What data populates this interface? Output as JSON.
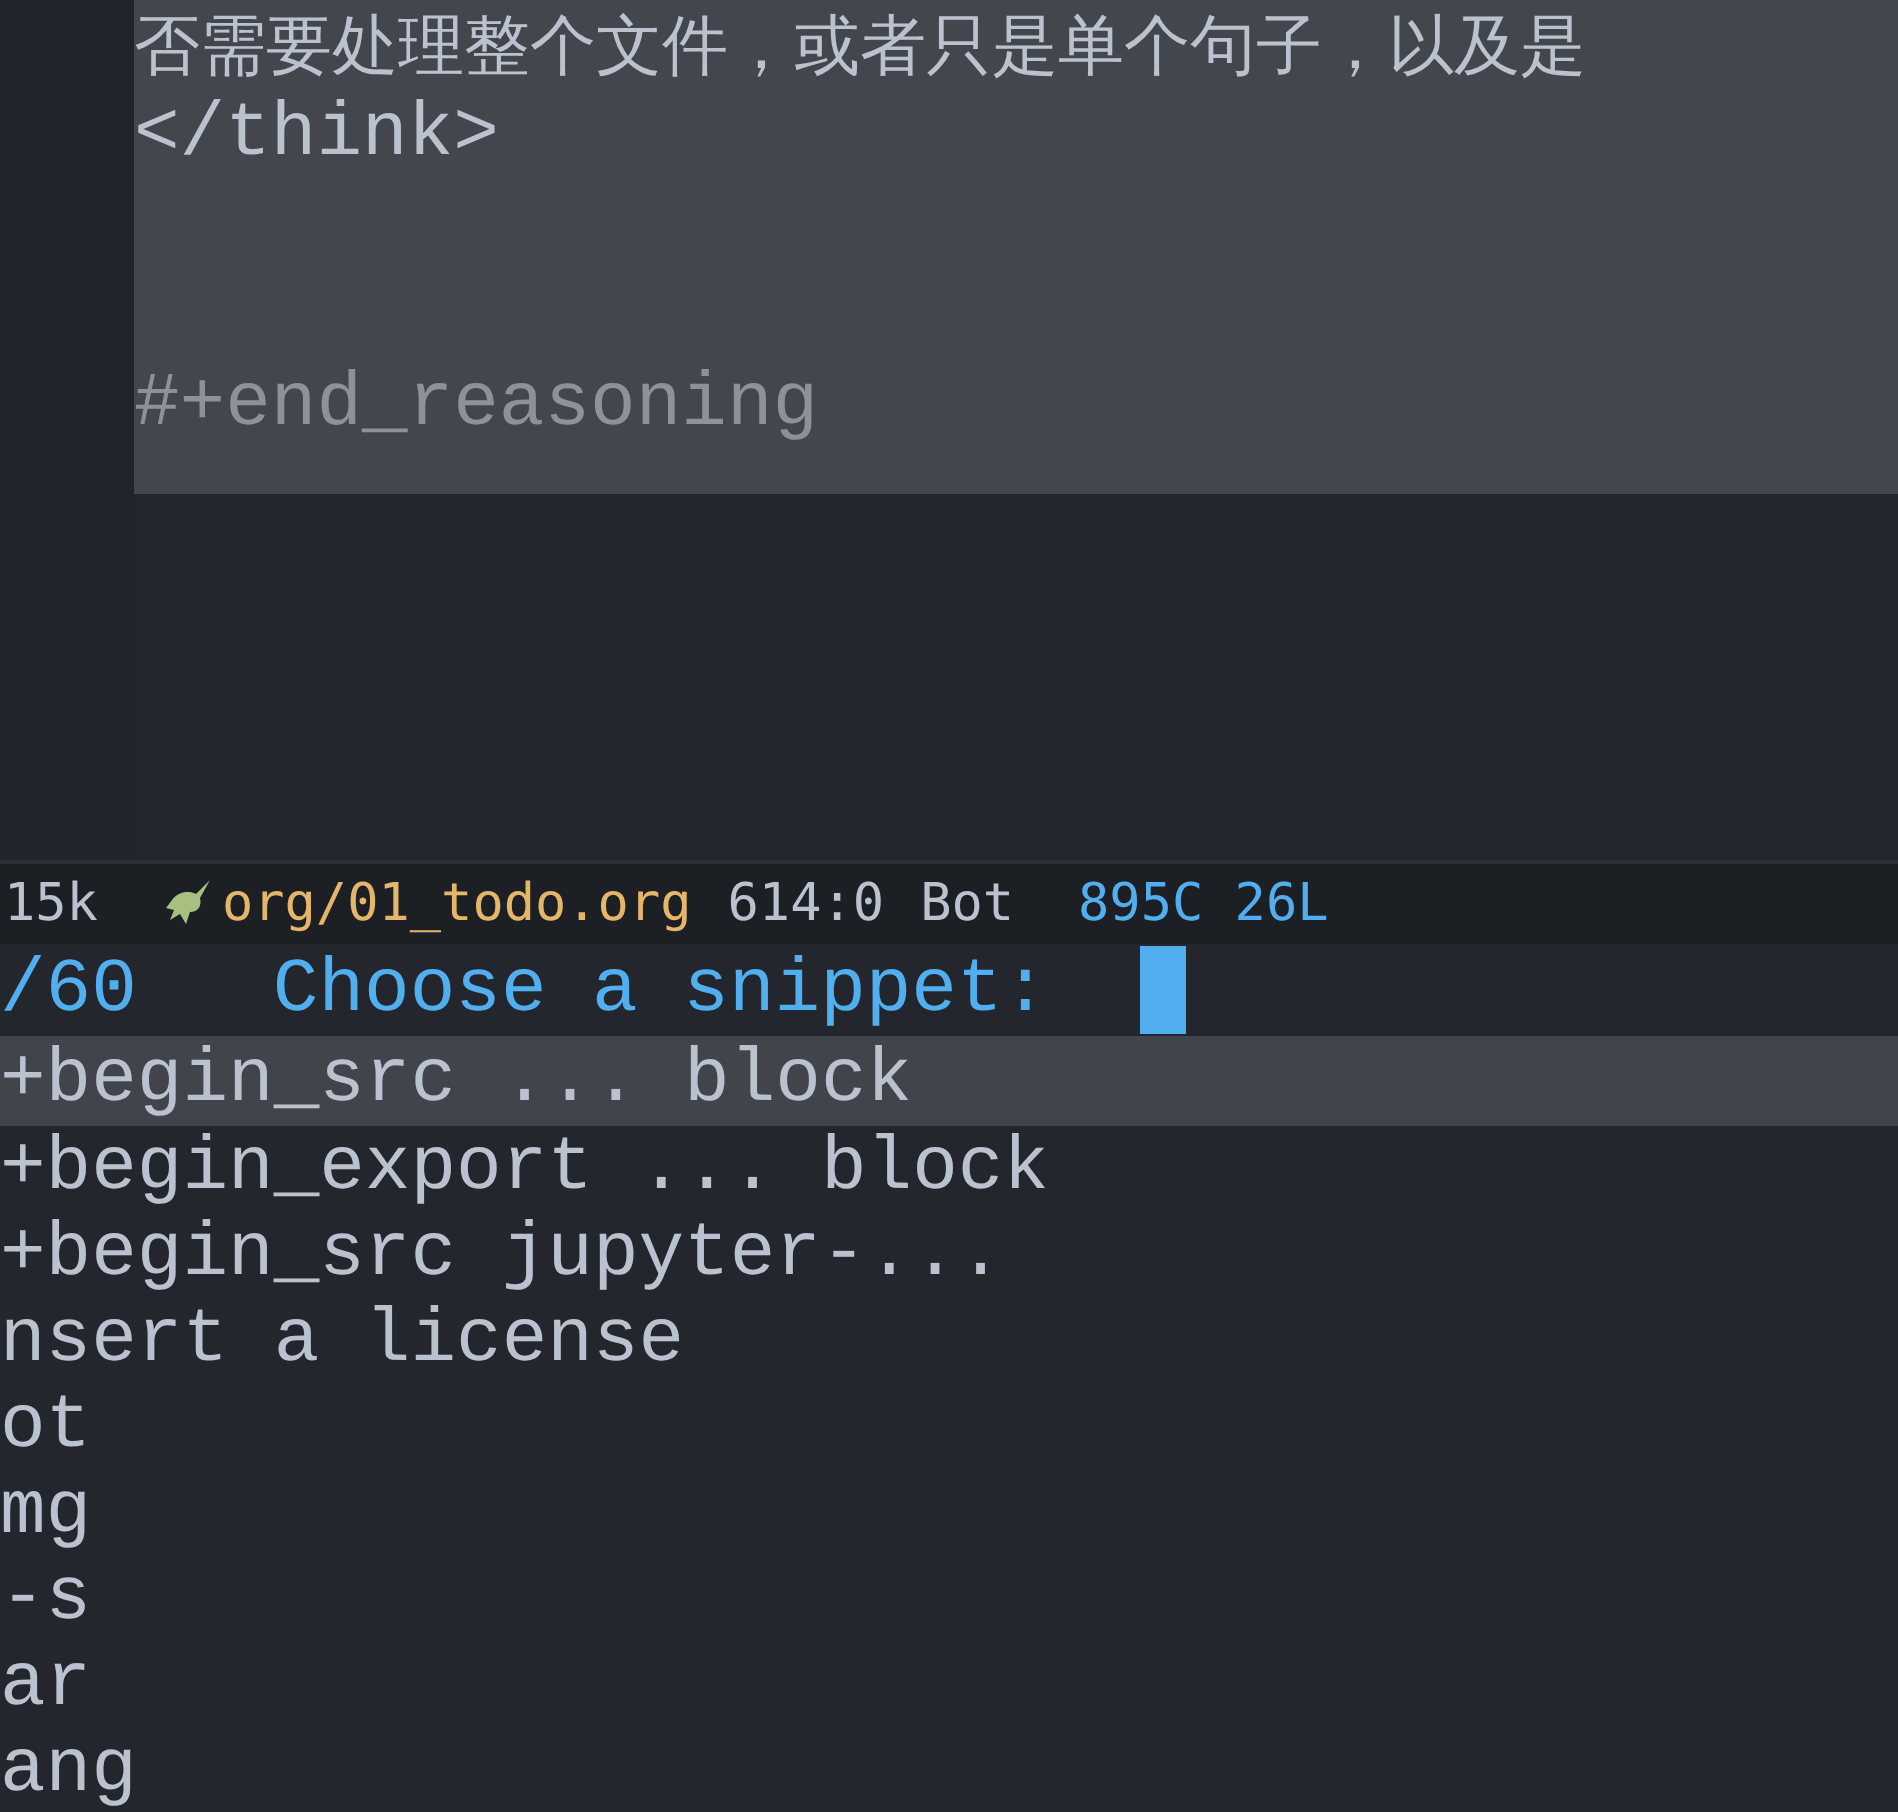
{
  "editor": {
    "region_active": true,
    "lines": [
      {
        "text": "否需要处理整个文件，或者只是单个句子，以及是",
        "kind": "cjk"
      },
      {
        "text": "</think>",
        "kind": "text"
      },
      {
        "kind": "blank"
      },
      {
        "kind": "blank"
      },
      {
        "text": "#+end_reasoning",
        "kind": "comment"
      }
    ]
  },
  "mode_line": {
    "buffer_size": "15k",
    "file_name": "org/01_todo.org",
    "position": "614:0",
    "scroll": "Bot",
    "stats": "895C 26L"
  },
  "minibuffer": {
    "counter": "/60",
    "prompt": "Choose a snippet:"
  },
  "candidates": [
    {
      "text": "+begin_src ... block",
      "selected": true
    },
    {
      "text": "+begin_export ... block",
      "selected": false
    },
    {
      "text": "+begin_src jupyter-...",
      "selected": false
    },
    {
      "text": "nsert a license",
      "selected": false
    },
    {
      "text": "ot",
      "selected": false
    },
    {
      "text": "mg",
      "selected": false
    },
    {
      "text": "-s",
      "selected": false
    },
    {
      "text": "ar",
      "selected": false
    },
    {
      "text": "ang",
      "selected": false
    }
  ]
}
